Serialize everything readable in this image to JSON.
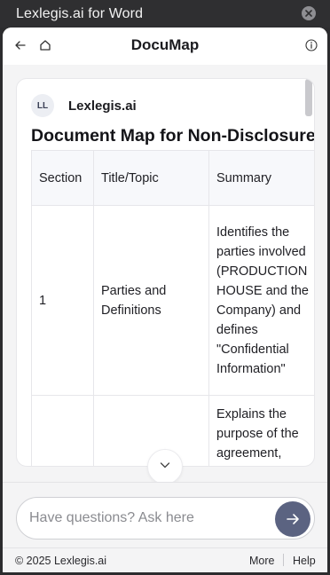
{
  "window": {
    "title": "Lexlegis.ai for Word"
  },
  "header": {
    "title": "DocuMap"
  },
  "card": {
    "avatar_initials": "LL",
    "brand_name": "Lexlegis.ai",
    "doc_title": "Document Map for Non-Disclosure Agreement"
  },
  "table": {
    "headers": [
      "Section",
      "Title/Topic",
      "Summary"
    ],
    "rows": [
      {
        "section": "1",
        "title": "Parties and Definitions",
        "summary": "Identifies the parties involved (PRODUCTION HOUSE and the Company) and defines \"Confidential Information\""
      },
      {
        "section": "",
        "title": "",
        "summary": "Explains the purpose of the agreement,"
      }
    ]
  },
  "input": {
    "placeholder": "Have questions? Ask here"
  },
  "footer": {
    "copyright": "© 2025 Lexlegis.ai",
    "more": "More",
    "help": "Help"
  },
  "icons": {
    "close": "close-icon",
    "back": "arrow-left-icon",
    "home": "home-icon",
    "info": "info-icon",
    "chevron": "chevron-down-icon",
    "send": "arrow-right-icon"
  },
  "colors": {
    "send_button": "#5b6381",
    "titlebar": "#2f2f31"
  }
}
